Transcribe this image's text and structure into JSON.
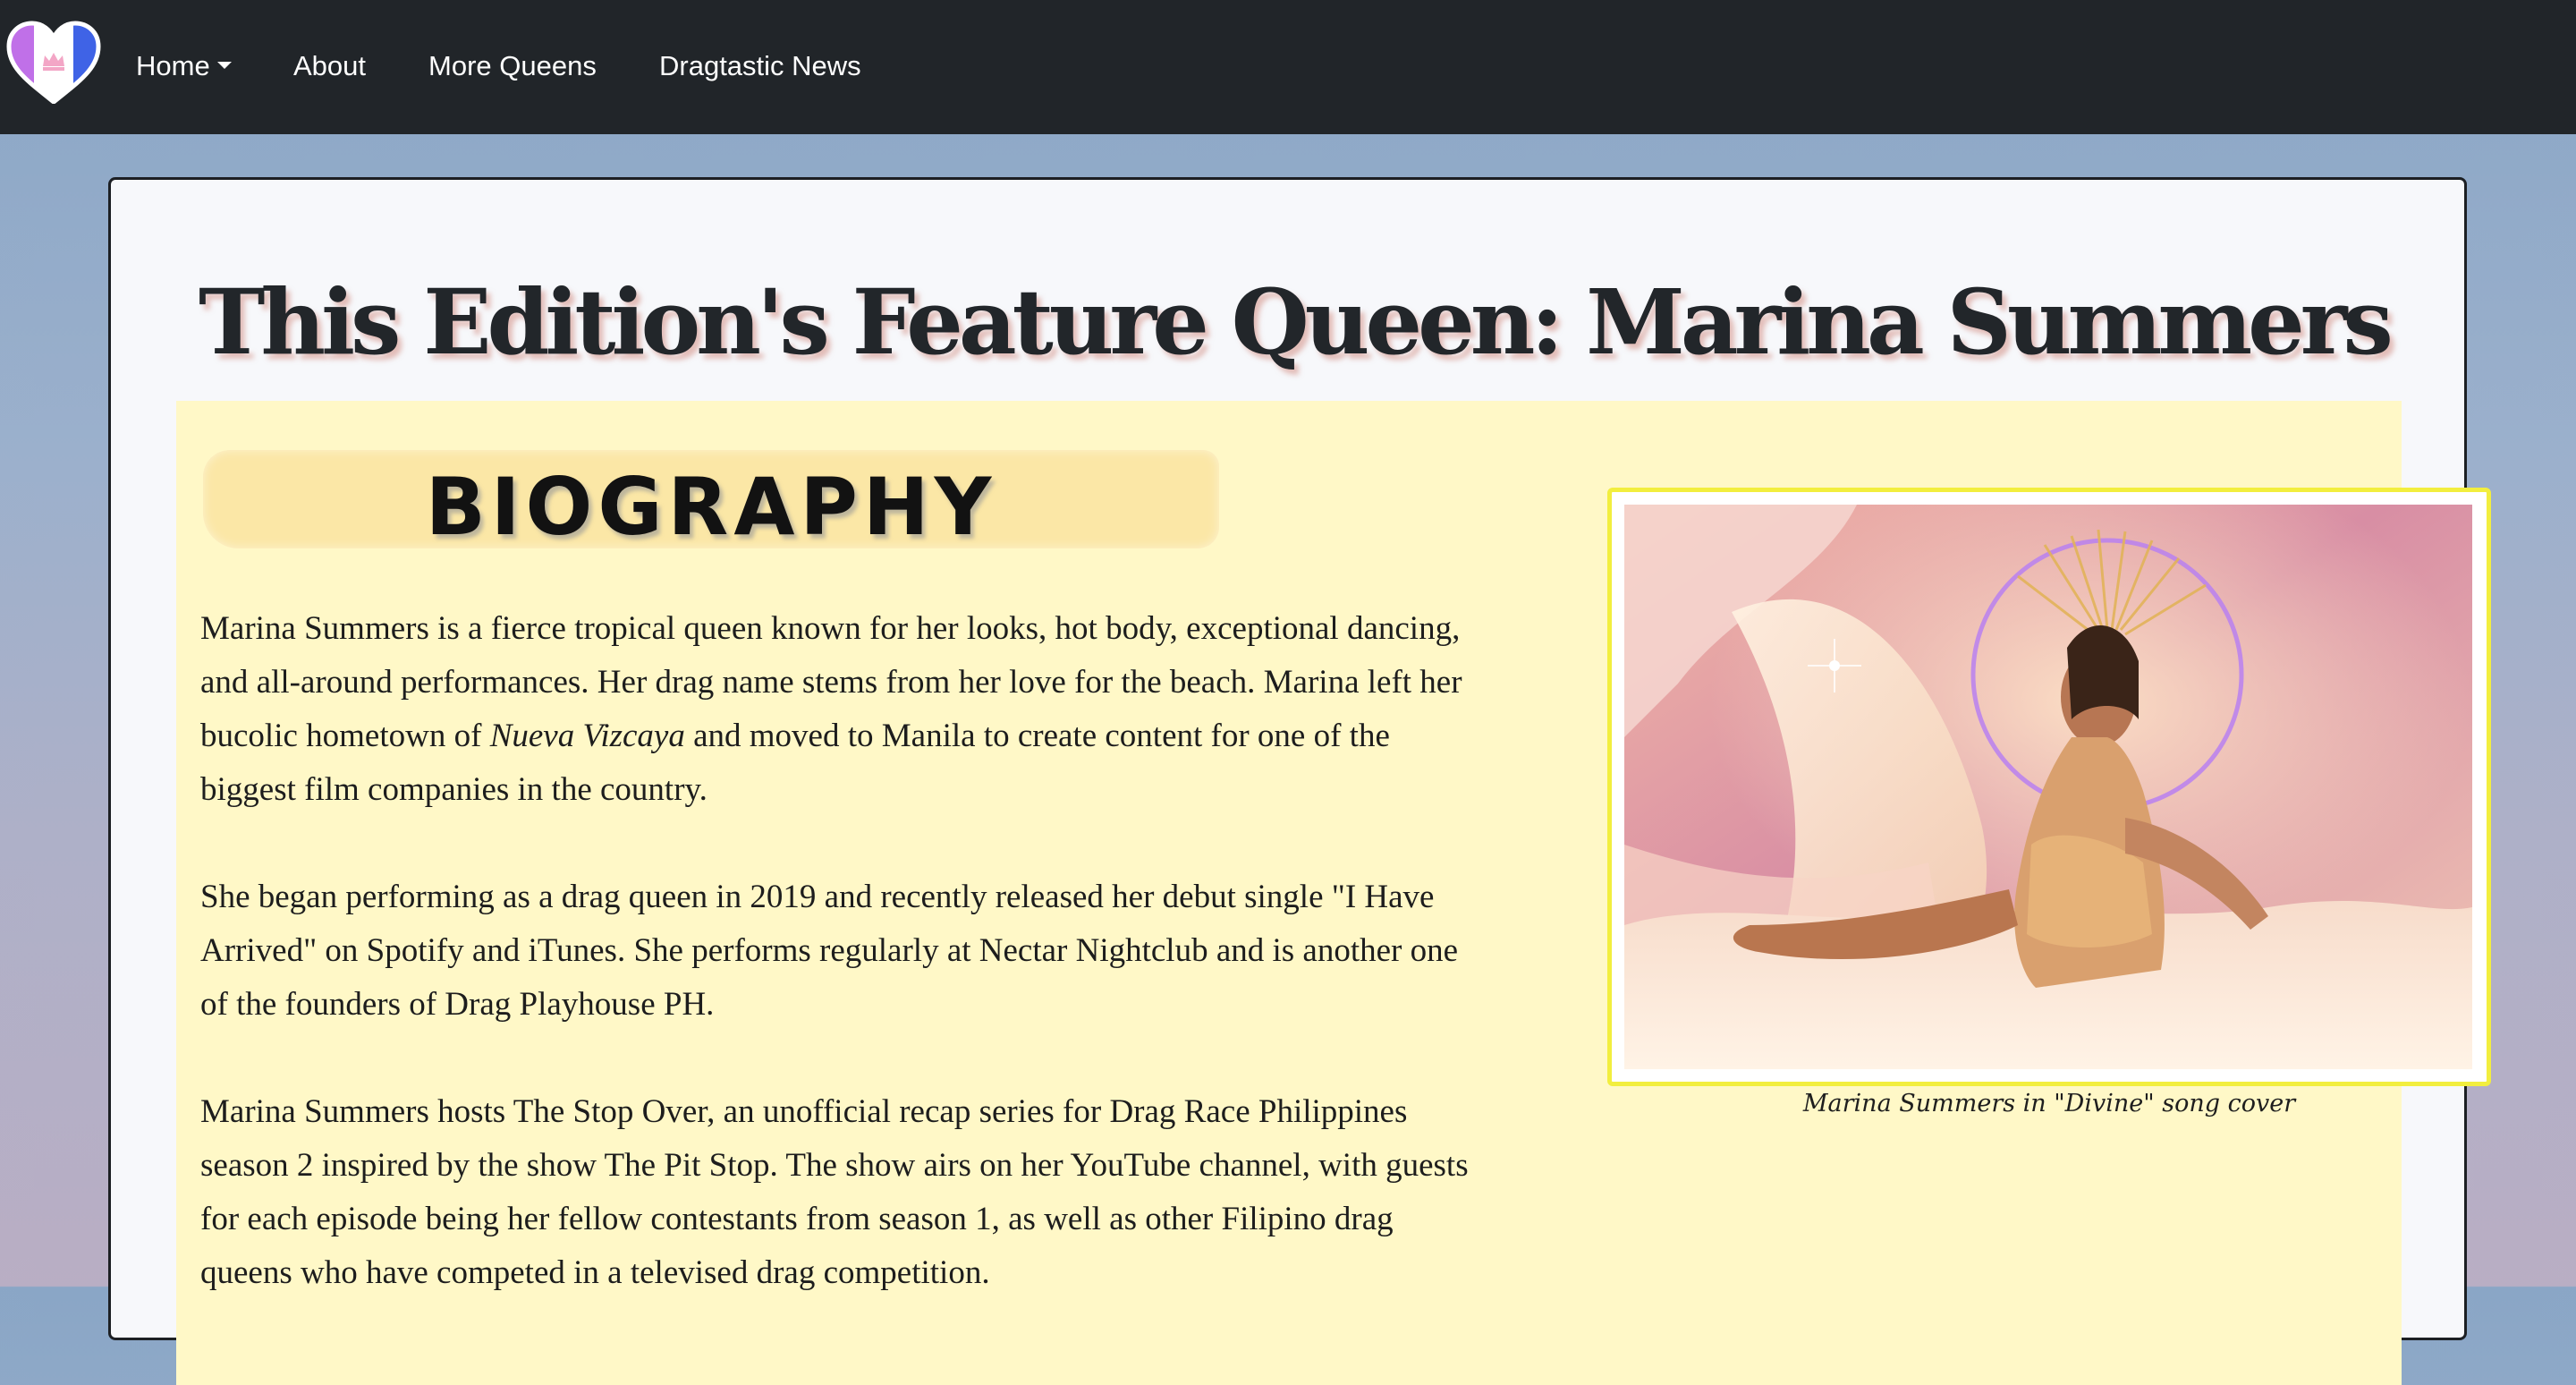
{
  "navbar": {
    "logo_icon": "heart-crown-logo-icon",
    "items": [
      {
        "label": "Home",
        "has_dropdown": true
      },
      {
        "label": "About"
      },
      {
        "label": "More Queens"
      },
      {
        "label": "Dragtastic News"
      }
    ]
  },
  "feature": {
    "title": "This Edition's Feature Queen: Marina Summers",
    "bio_heading": "BIOGRAPHY",
    "paragraphs": {
      "p1_before": "Marina Summers is a fierce tropical queen known for her looks, hot body, exceptional dancing, and all-around performances. Her drag name stems from her love for the beach. Marina left her bucolic hometown of ",
      "p1_emph": "Nueva Vizcaya",
      "p1_after": " and moved to Manila to create content for one of the biggest film companies in the country.",
      "p2": "She began performing as a drag queen in 2019 and recently released her debut single \"I Have Arrived\" on Spotify and iTunes. She performs regularly at Nectar Nightclub and is another one of the founders of Drag Playhouse PH.",
      "p3": "Marina Summers hosts The Stop Over, an unofficial recap series for Drag Race Philippines season 2 inspired by the show The Pit Stop. The show airs on her YouTube channel, with guests for each episode being her fellow contestants from season 1, as well as other Filipino drag queens who have competed in a televised drag competition."
    },
    "image_caption": "Marina Summers in \"Divine\" song cover"
  },
  "colors": {
    "navbar_bg": "#212529",
    "card_bg": "#f7f8fb",
    "bio_panel_bg": "#fff8c7",
    "frame_border": "#f2ee3e"
  }
}
